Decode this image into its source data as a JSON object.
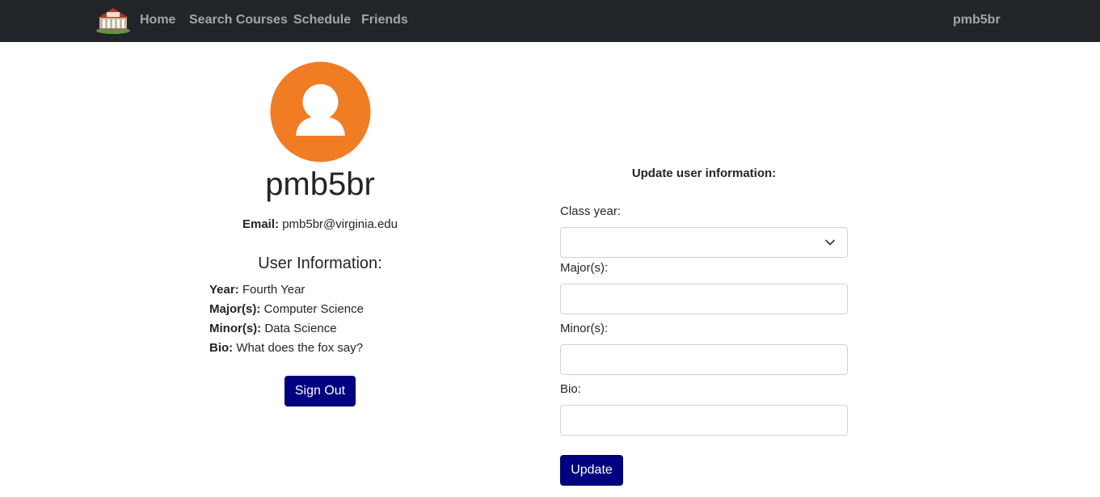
{
  "nav": {
    "links": [
      "Home",
      "Search Courses",
      "Schedule",
      "Friends"
    ],
    "user": "pmb5br",
    "logo_icon": "building-logo-icon"
  },
  "profile": {
    "avatar_icon": "user-avatar-icon",
    "avatar_color": "#f07c24",
    "username": "pmb5br",
    "email_label": "Email:",
    "email": "pmb5br@virginia.edu",
    "info_heading": "User Information:",
    "fields": [
      {
        "label": "Year:",
        "value": "Fourth Year"
      },
      {
        "label": "Major(s):",
        "value": "Computer Science"
      },
      {
        "label": "Minor(s):",
        "value": "Data Science"
      },
      {
        "label": "Bio:",
        "value": "What does the fox say?"
      }
    ],
    "signout_label": "Sign Out"
  },
  "form": {
    "title": "Update user information:",
    "class_year_label": "Class year:",
    "class_year_value": "",
    "major_label": "Major(s):",
    "major_value": "",
    "minor_label": "Minor(s):",
    "minor_value": "",
    "bio_label": "Bio:",
    "bio_value": "",
    "update_label": "Update"
  },
  "colors": {
    "navbar_bg": "#212529",
    "nav_text": "#a4a5a8",
    "button_bg": "#000080",
    "avatar": "#f07c24"
  }
}
